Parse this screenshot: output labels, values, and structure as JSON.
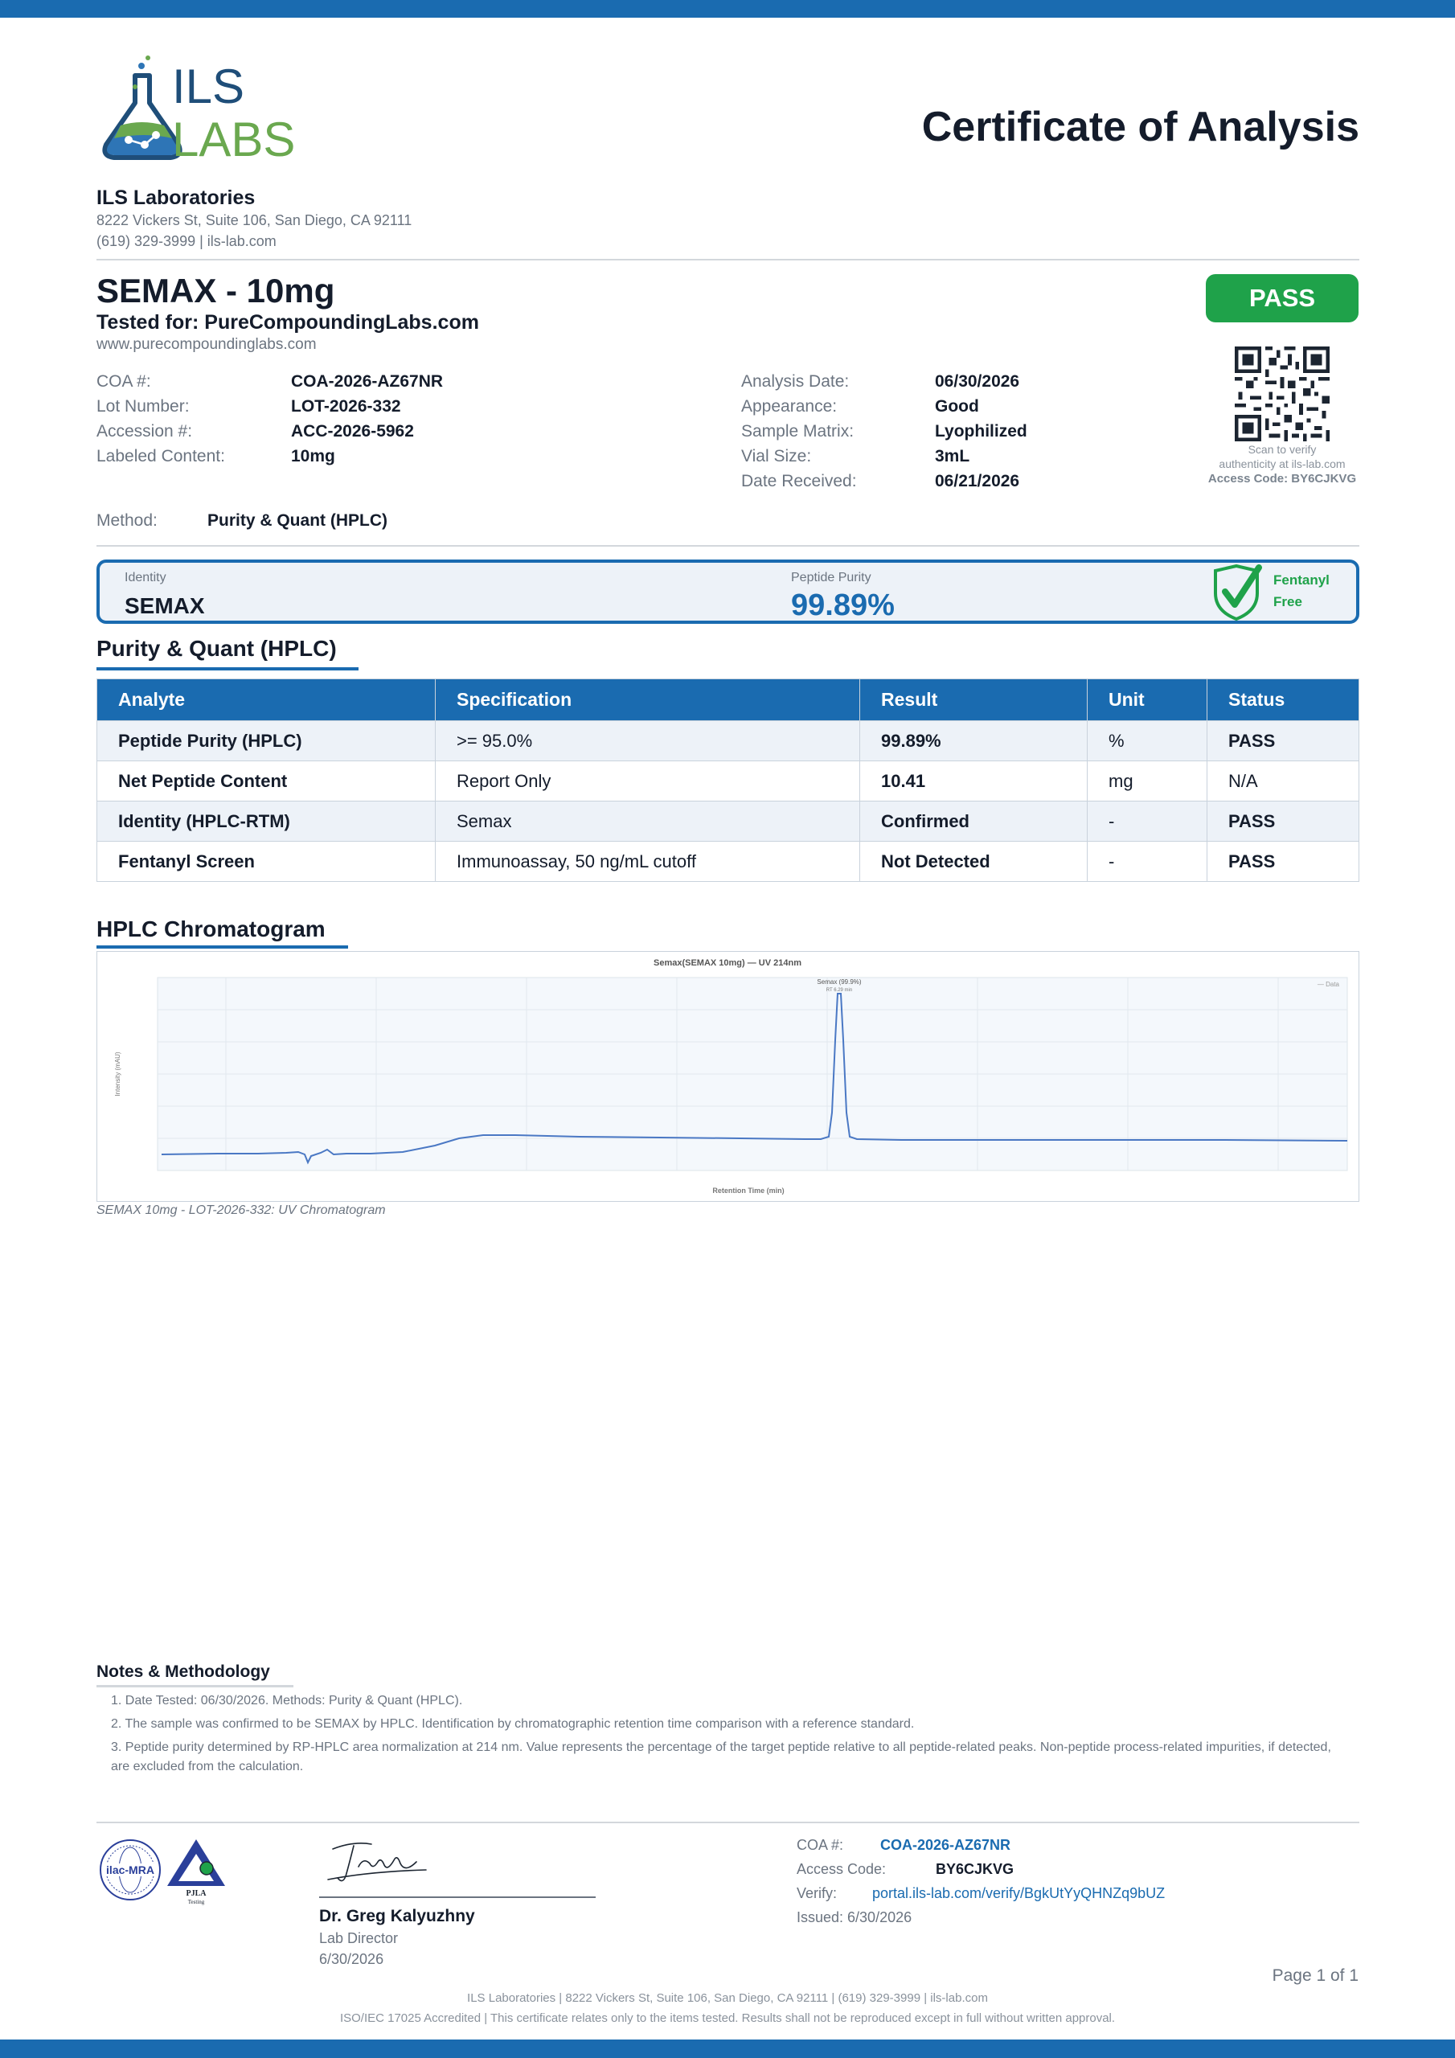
{
  "header": {
    "logo_top": "ILS",
    "logo_bottom": "LABS",
    "doc_title": "Certificate of Analysis",
    "lab_name": "ILS Laboratories",
    "lab_address": "8222 Vickers St, Suite 106, San Diego, CA 92111",
    "lab_phone": "(619) 329-3999  |  ils-lab.com"
  },
  "product": {
    "name": "SEMAX - 10mg",
    "tested_for": "Tested for: PureCompoundingLabs.com",
    "client_url": "www.purecompoundinglabs.com",
    "status": "PASS"
  },
  "qr": {
    "scan_text_1": "Scan to verify",
    "scan_text_2": "authenticity at ils-lab.com",
    "access_code": "Access Code: BY6CJKVG"
  },
  "meta_left": [
    {
      "label": "COA #:",
      "value": "COA-2026-AZ67NR"
    },
    {
      "label": "Lot Number:",
      "value": "LOT-2026-332"
    },
    {
      "label": "Accession #:",
      "value": "ACC-2026-5962"
    },
    {
      "label": "Labeled Content:",
      "value": "10mg"
    }
  ],
  "meta_right": [
    {
      "label": "Analysis Date:",
      "value": "06/30/2026"
    },
    {
      "label": "Appearance:",
      "value": "Good"
    },
    {
      "label": "Sample Matrix:",
      "value": "Lyophilized"
    },
    {
      "label": "Vial Size:",
      "value": "3mL"
    },
    {
      "label": "Date Received:",
      "value": "06/21/2026"
    }
  ],
  "method": {
    "label": "Method:",
    "value": "Purity & Quant (HPLC)"
  },
  "summary": {
    "identity_label": "Identity",
    "identity_value": "SEMAX",
    "purity_label": "Peptide Purity",
    "purity_value": "99.89%",
    "fentanyl_1": "Fentanyl",
    "fentanyl_2": "Free"
  },
  "results": {
    "section_title": "Purity & Quant (HPLC)",
    "headers": [
      "Analyte",
      "Specification",
      "Result",
      "Unit",
      "Status"
    ],
    "rows": [
      [
        "Peptide Purity (HPLC)",
        ">= 95.0%",
        "99.89%",
        "%",
        "PASS"
      ],
      [
        "Net Peptide Content",
        "Report Only",
        "10.41",
        "mg",
        "N/A"
      ],
      [
        "Identity (HPLC-RTM)",
        "Semax",
        "Confirmed",
        "-",
        "PASS"
      ],
      [
        "Fentanyl Screen",
        "Immunoassay, 50 ng/mL cutoff",
        "Not Detected",
        "-",
        "PASS"
      ]
    ]
  },
  "chromatogram": {
    "section_title": "HPLC Chromatogram",
    "plot_title": "Semax(SEMAX 10mg) — UV 214nm",
    "peak_label": "Semax (99.9%)",
    "peak_sublabel": "RT 6.29 min",
    "legend": "— Data",
    "ylabel": "Intensity (mAU)",
    "xlabel": "Retention Time (min)",
    "caption": "SEMAX 10mg - LOT-2026-332: UV Chromatogram"
  },
  "notes": {
    "title": "Notes & Methodology",
    "items": [
      "1. Date Tested: 06/30/2026. Methods: Purity & Quant (HPLC).",
      "2. The sample was confirmed to be SEMAX by HPLC. Identification by chromatographic retention time comparison with a reference standard.",
      "3. Peptide purity determined by RP-HPLC area normalization at 214 nm. Value represents the percentage of the target peptide relative to all peptide-related peaks. Non-peptide process-related impurities, if detected, are excluded from the calculation."
    ]
  },
  "accreditation": {
    "ilac": "ilac-MRA",
    "pjla": "PJLA",
    "pjla_sub": "Testing"
  },
  "signature": {
    "name": "Dr. Greg Kalyuzhny",
    "role": "Lab Director",
    "date": "6/30/2026"
  },
  "footer_info": {
    "coa_label": "COA #:",
    "coa_value": "COA-2026-AZ67NR",
    "access_label": "Access Code:",
    "access_value": "BY6CJKVG",
    "verify_label": "Verify:",
    "verify_url": "portal.ils-lab.com/verify/BgkUtYyQHNZq9bUZ",
    "issued": "Issued: 6/30/2026"
  },
  "page": "Page 1 of 1",
  "footer_line_1": "ILS Laboratories  |  8222 Vickers St, Suite 106, San Diego, CA 92111  |  (619) 329-3999  |  ils-lab.com",
  "footer_line_2": "ISO/IEC 17025 Accredited  |  This certificate relates only to the items tested. Results shall not be reproduced except in full without written approval.",
  "colors": {
    "brand_blue": "#1a6bb0",
    "pass_green": "#1fa24a",
    "logo_navy": "#1f4e79",
    "logo_green": "#6aa84f"
  }
}
